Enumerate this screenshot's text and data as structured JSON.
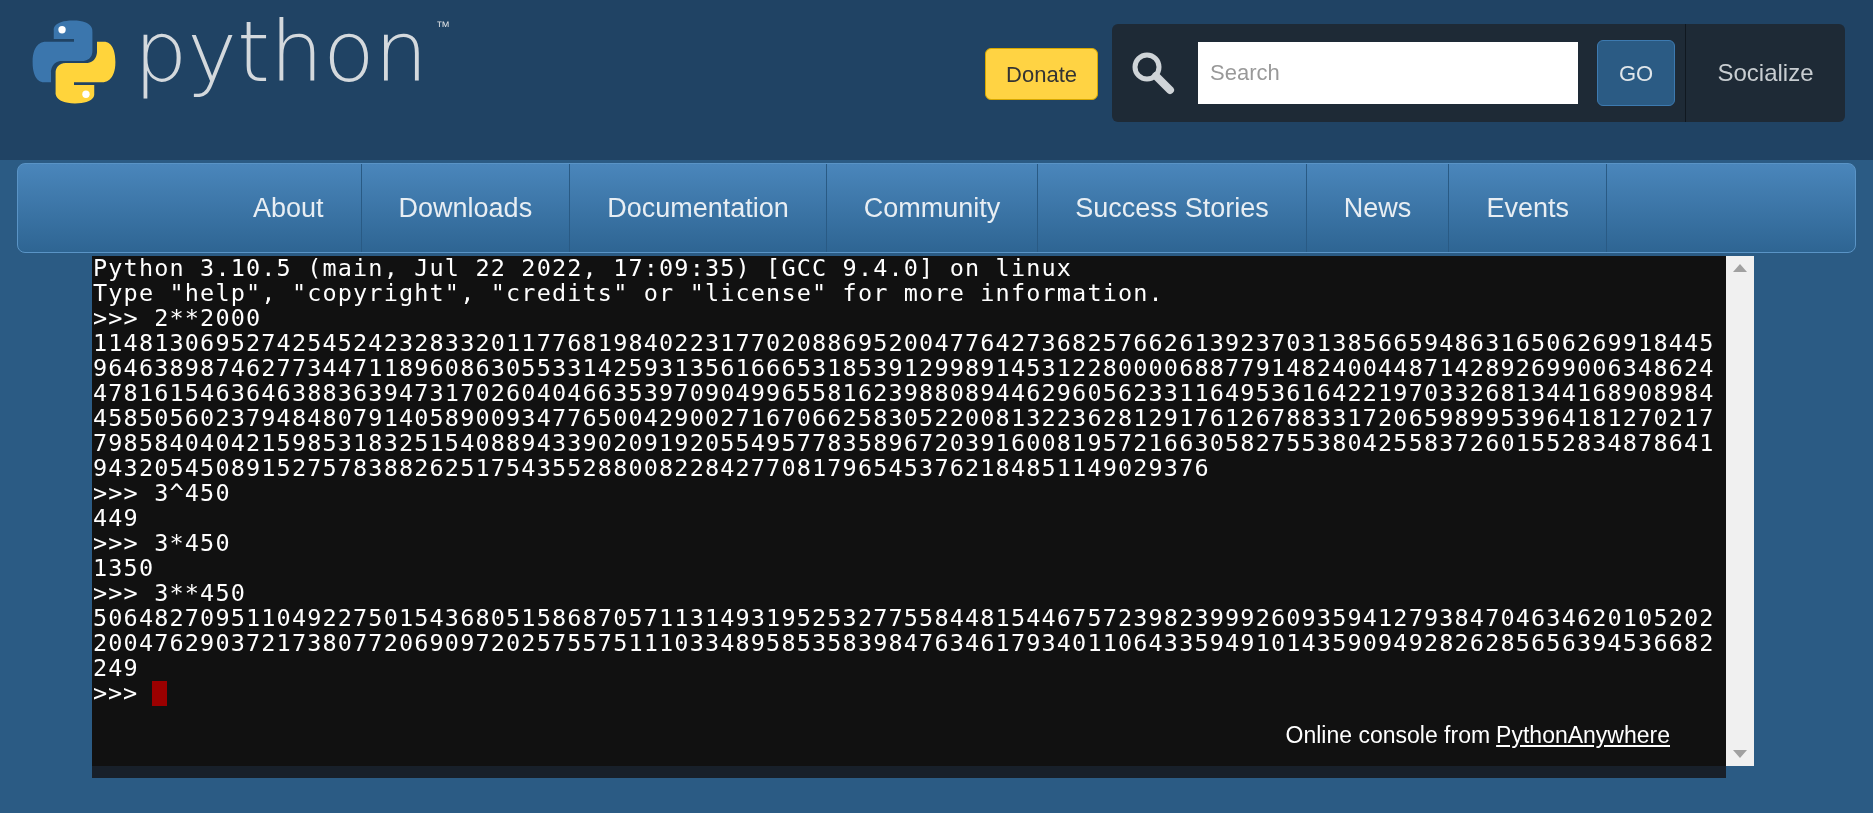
{
  "header": {
    "logo_text": "python",
    "trademark": "™",
    "donate_button": "Donate",
    "search": {
      "placeholder": "Search"
    },
    "go_button": "GO",
    "socialize_button": "Socialize"
  },
  "nav": [
    {
      "label": "About"
    },
    {
      "label": "Downloads"
    },
    {
      "label": "Documentation"
    },
    {
      "label": "Community"
    },
    {
      "label": "Success Stories"
    },
    {
      "label": "News"
    },
    {
      "label": "Events"
    }
  ],
  "console": {
    "lines": [
      "Python 3.10.5 (main, Jul 22 2022, 17:09:35) [GCC 9.4.0] on linux",
      "Type \"help\", \"copyright\", \"credits\" or \"license\" for more information.",
      ">>> 2**2000",
      "1148130695274254524232833201177681984022317702088695200477642736825766261392370313856659486316506269918445",
      "9646389874627734471189608630553314259313561666531853912998914531228000068877914824004487142892699006348624",
      "4781615463646388363947317026040466353970904996558162398808944629605623311649536164221970332681344168908984",
      "4585056023794848079140589009347765004290027167066258305220081322362812917612678833172065989953964181270217",
      "7985840404215985318325154088943390209192055495778358967203916008195721663058275538042558372601552834878641",
      "9432054508915275783882625175435528800822842770817965453762184851149029376",
      ">>> 3^450",
      "449",
      ">>> 3*450",
      "1350",
      ">>> 3**450",
      "5064827095110492275015436805158687057113149319525327755844815446757239823999260935941279384704634620105202",
      "2004762903721738077206909720257557511103348958535839847634617934011064335949101435909492826285656394536682",
      "249"
    ],
    "input_prompt": ">>>",
    "footer": {
      "text": "Online console from",
      "link": "PythonAnywhere"
    }
  }
}
